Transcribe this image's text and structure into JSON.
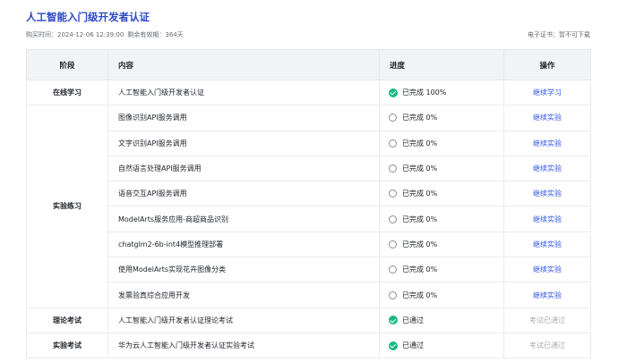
{
  "header": {
    "title": "人工智能入门级开发者认证",
    "purchase_label": "购买时间：",
    "purchase_time": "2024-12-06 12:39:00",
    "validity_label": "剩余有效期：",
    "validity_value": "364天",
    "cert_label": "电子证书：",
    "cert_value": "暂不可下载"
  },
  "table": {
    "columns": [
      "阶段",
      "内容",
      "进度",
      "操作"
    ],
    "rows": [
      {
        "stage": "在线学习",
        "content": "人工智能入门级开发者认证",
        "progress": "已完成 100%",
        "status": "done",
        "action": "继续学习"
      },
      {
        "stage": "实验练习",
        "content": "图像识别API服务调用",
        "progress": "已完成 0%",
        "status": "todo",
        "action": "继续实验"
      },
      {
        "stage": "",
        "content": "文字识别API服务调用",
        "progress": "已完成 0%",
        "status": "todo",
        "action": "继续实验"
      },
      {
        "stage": "",
        "content": "自然语言处理API服务调用",
        "progress": "已完成 0%",
        "status": "todo",
        "action": "继续实验"
      },
      {
        "stage": "",
        "content": "语音交互API服务调用",
        "progress": "已完成 0%",
        "status": "todo",
        "action": "继续实验"
      },
      {
        "stage": "",
        "content": "ModelArts服务应用-商超商品识别",
        "progress": "已完成 0%",
        "status": "todo",
        "action": "继续实验"
      },
      {
        "stage": "",
        "content": "chatglm2-6b-int4模型推理部署",
        "progress": "已完成 0%",
        "status": "todo",
        "action": "继续实验"
      },
      {
        "stage": "",
        "content": "使用ModelArts实现花卉图像分类",
        "progress": "已完成 0%",
        "status": "todo",
        "action": "继续实验"
      },
      {
        "stage": "",
        "content": "发票验真综合应用开发",
        "progress": "已完成 0%",
        "status": "todo",
        "action": "继续实验"
      },
      {
        "stage": "理论考试",
        "content": "人工智能入门级开发者认证理论考试",
        "progress": "已通过",
        "status": "done",
        "action": "考试已通过"
      },
      {
        "stage": "实验考试",
        "content": "华为云人工智能入门级开发者认证实验考试",
        "progress": "已通过",
        "status": "done",
        "action": "考试已通过"
      }
    ]
  },
  "colors": {
    "accent": "#2c49c7",
    "link": "#2f54eb",
    "success": "#19b980",
    "header_bg": "#f1f3f7",
    "disabled": "#a8acb2"
  },
  "icons": {
    "done": "check-circle-icon",
    "todo": "empty-circle-icon"
  }
}
